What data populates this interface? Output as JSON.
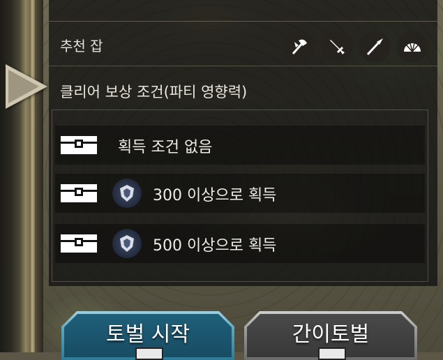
{
  "recommended_jobs": {
    "label": "추천 잡",
    "icons": [
      "axe-icon",
      "sword-icon",
      "spear-icon",
      "fan-icon"
    ]
  },
  "clear_rewards": {
    "title": "클리어 보상 조건(파티 영향력)",
    "rows": [
      {
        "icon": "treasure-chest-icon",
        "text": "획득 조건 없음",
        "has_seal": false
      },
      {
        "icon": "treasure-chest-icon",
        "text": "300 이상으로 획득",
        "has_seal": true
      },
      {
        "icon": "treasure-chest-icon",
        "text": "500 이상으로 획득",
        "has_seal": true
      }
    ]
  },
  "buttons": {
    "start": "토벌 시작",
    "simple": "간이토벌"
  },
  "colors": {
    "start_button": "#2f7b97",
    "simple_button": "#6c6c6c",
    "panel_bg": "#0c0c0e",
    "text": "#f0ede6"
  }
}
